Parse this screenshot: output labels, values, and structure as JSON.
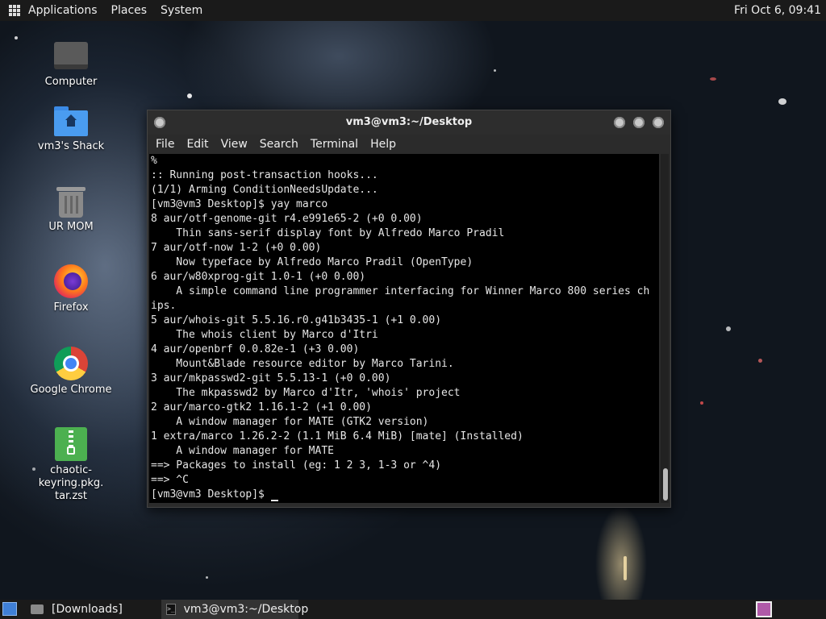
{
  "top_panel": {
    "menu": [
      "Applications",
      "Places",
      "System"
    ],
    "clock": "Fri Oct  6, 09:41"
  },
  "desktop_icons": [
    {
      "label": "Computer",
      "icon": "computer-icon"
    },
    {
      "label": "vm3's Shack",
      "icon": "home-folder-icon"
    },
    {
      "label": "UR MOM",
      "icon": "trash-icon"
    },
    {
      "label": "Firefox",
      "icon": "firefox-icon"
    },
    {
      "label": "Google Chrome",
      "icon": "chrome-icon"
    },
    {
      "label": "chaotic-keyring.pkg.\ntar.zst",
      "icon": "archive-file-icon"
    }
  ],
  "terminal": {
    "title": "vm3@vm3:~/Desktop",
    "menu": [
      "File",
      "Edit",
      "View",
      "Search",
      "Terminal",
      "Help"
    ],
    "lines": [
      "%",
      ":: Running post-transaction hooks...",
      "(1/1) Arming ConditionNeedsUpdate...",
      "[vm3@vm3 Desktop]$ yay marco",
      "8 aur/otf-genome-git r4.e991e65-2 (+0 0.00)",
      "    Thin sans-serif display font by Alfredo Marco Pradil",
      "7 aur/otf-now 1-2 (+0 0.00)",
      "    Now typeface by Alfredo Marco Pradil (OpenType)",
      "6 aur/w80xprog-git 1.0-1 (+0 0.00)",
      "    A simple command line programmer interfacing for Winner Marco 800 series ch",
      "ips.",
      "5 aur/whois-git 5.5.16.r0.g41b3435-1 (+1 0.00)",
      "    The whois client by Marco d'Itri",
      "4 aur/openbrf 0.0.82e-1 (+3 0.00)",
      "    Mount&Blade resource editor by Marco Tarini.",
      "3 aur/mkpasswd2-git 5.5.13-1 (+0 0.00)",
      "    The mkpasswd2 by Marco d'Itr, 'whois' project",
      "2 aur/marco-gtk2 1.16.1-2 (+1 0.00)",
      "    A window manager for MATE (GTK2 version)",
      "1 extra/marco 1.26.2-2 (1.1 MiB 6.4 MiB) [mate] (Installed)",
      "    A window manager for MATE",
      "==> Packages to install (eg: 1 2 3, 1-3 or ^4)",
      "==> ^C"
    ],
    "prompt": "[vm3@vm3 Desktop]$ "
  },
  "bottom_panel": {
    "tasks": [
      {
        "label": "[Downloads]",
        "icon": "folder-icon"
      },
      {
        "label": "vm3@vm3:~/Desktop",
        "icon": "terminal-icon"
      }
    ]
  }
}
